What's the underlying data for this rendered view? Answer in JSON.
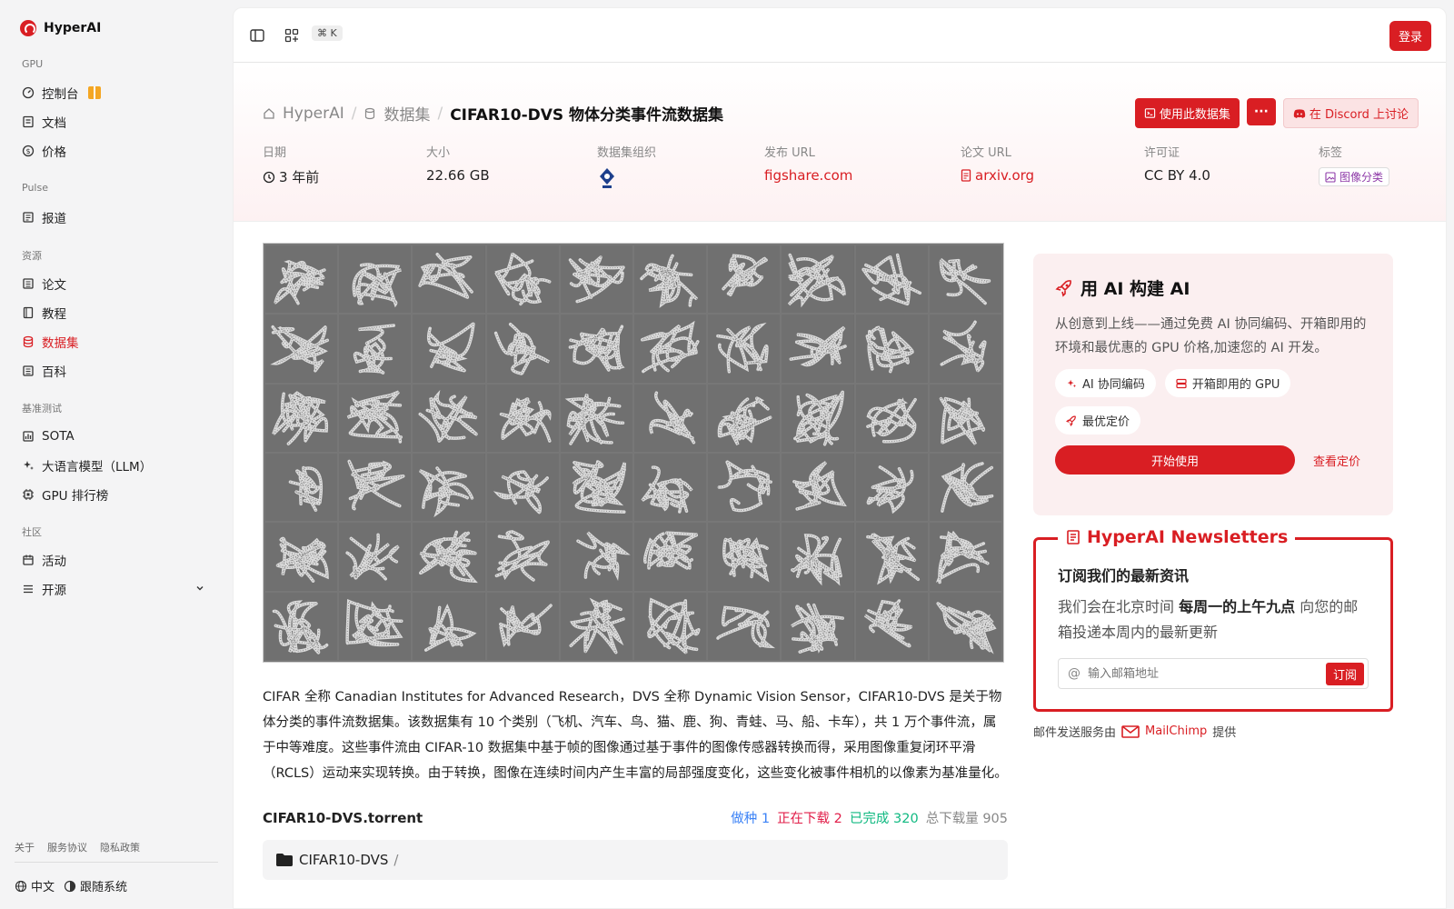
{
  "brand": "HyperAI",
  "sidebar": {
    "sections": [
      {
        "title": "GPU",
        "items": [
          {
            "label": "控制台",
            "icon": "gauge-icon"
          },
          {
            "label": "文档",
            "icon": "doc-icon"
          },
          {
            "label": "价格",
            "icon": "dollar-icon"
          }
        ]
      },
      {
        "title": "Pulse",
        "items": [
          {
            "label": "报道",
            "icon": "news-icon"
          }
        ]
      },
      {
        "title": "资源",
        "items": [
          {
            "label": "论文",
            "icon": "paper-icon"
          },
          {
            "label": "教程",
            "icon": "book-icon"
          },
          {
            "label": "数据集",
            "icon": "database-icon",
            "active": true
          },
          {
            "label": "百科",
            "icon": "wiki-icon"
          }
        ]
      },
      {
        "title": "基准测试",
        "items": [
          {
            "label": "SOTA",
            "icon": "chart-icon"
          },
          {
            "label": "大语言模型（LLM）",
            "icon": "sparkle-icon"
          },
          {
            "label": "GPU 排行榜",
            "icon": "chip-icon"
          }
        ]
      },
      {
        "title": "社区",
        "items": [
          {
            "label": "活动",
            "icon": "calendar-icon"
          },
          {
            "label": "开源",
            "icon": "list-icon"
          }
        ]
      }
    ],
    "footer_links": [
      "关于",
      "服务协议",
      "隐私政策"
    ],
    "language": "中文",
    "theme": "跟随系统"
  },
  "topbar": {
    "shortcut": "⌘ K",
    "login": "登录"
  },
  "breadcrumb": {
    "home": "HyperAI",
    "section": "数据集",
    "current": "CIFAR10-DVS 物体分类事件流数据集"
  },
  "actions": {
    "use": "使用此数据集",
    "more": "···",
    "discord": "在 Discord 上讨论"
  },
  "meta": {
    "date_label": "日期",
    "date": "3 年前",
    "size_label": "大小",
    "size": "22.66 GB",
    "org_label": "数据集组织",
    "publish_label": "发布 URL",
    "publish": "figshare.com",
    "paper_label": "论文 URL",
    "paper": "arxiv.org",
    "license_label": "许可证",
    "license": "CC BY 4.0",
    "tag_label": "标签",
    "tag": "图像分类"
  },
  "description": "CIFAR 全称 Canadian Institutes for Advanced Research，DVS 全称 Dynamic Vision Sensor，CIFAR10-DVS 是关于物体分类的事件流数据集。该数据集有 10 个类别（飞机、汽车、鸟、猫、鹿、狗、青蛙、马、船、卡车），共 1 万个事件流，属于中等难度。这些事件流由 CIFAR-10 数据集中基于帧的图像通过基于事件的图像传感器转换而得，采用图像重复闭环平滑（RCLS）运动来实现转换。由于转换，图像在连续时间内产生丰富的局部强度变化，这些变化被事件相机的以像素为基准量化。",
  "torrent": {
    "name": "CIFAR10-DVS.torrent",
    "seed_label": "做种",
    "seed": "1",
    "downloading_label": "正在下载",
    "downloading": "2",
    "done_label": "已完成",
    "done": "320",
    "total_label": "总下载量",
    "total": "905",
    "folder": "CIFAR10-DVS",
    "colors": {
      "seed": "#3b82f6",
      "downloading": "#e11d48",
      "done": "#10b981",
      "total": "#888888"
    }
  },
  "promo": {
    "title": "用 AI 构建 AI",
    "text": "从创意到上线——通过免费 AI 协同编码、开箱即用的环境和最优惠的 GPU 价格,加速您的 AI 开发。",
    "chips": [
      "AI 协同编码",
      "开箱即用的 GPU",
      "最优定价"
    ],
    "start": "开始使用",
    "pricing": "查看定价"
  },
  "newsletter": {
    "title": "HyperAI Newsletters",
    "heading": "订阅我们的最新资讯",
    "text_pre": "我们会在北京时间 ",
    "text_bold": "每周一的上午九点",
    "text_post": " 向您的邮箱投递本周内的最新更新",
    "placeholder": "输入邮箱地址",
    "subscribe": "订阅",
    "mail_pre": "邮件发送服务由",
    "mail_brand": "MailChimp",
    "mail_post": "提供"
  },
  "colors": {
    "accent": "#d91e23"
  }
}
